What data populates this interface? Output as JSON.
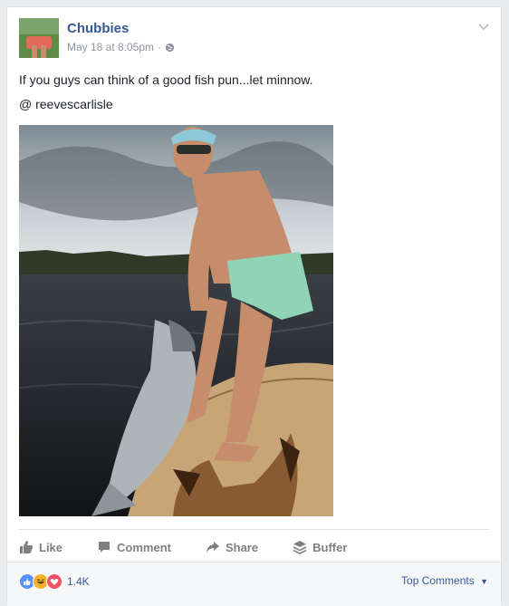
{
  "post": {
    "page_name": "Chubbies",
    "timestamp": "May 18 at 8:05pm",
    "separator": "·",
    "audience_icon": "globe-icon",
    "text": "If you guys can think of a good fish pun...let minnow.",
    "mention": "@ reevescarlisle",
    "menu_icon": "chevron-down-icon"
  },
  "actions": {
    "like": "Like",
    "comment": "Comment",
    "share": "Share",
    "buffer": "Buffer"
  },
  "reactions": {
    "icons": [
      "like-reaction-icon",
      "haha-reaction-icon",
      "love-reaction-icon"
    ],
    "colors": [
      "#5890ff",
      "#f7b125",
      "#f25268"
    ],
    "count": "1.4K"
  },
  "comments": {
    "filter_label": "Top Comments",
    "filter_icon": "caret-down-icon"
  }
}
